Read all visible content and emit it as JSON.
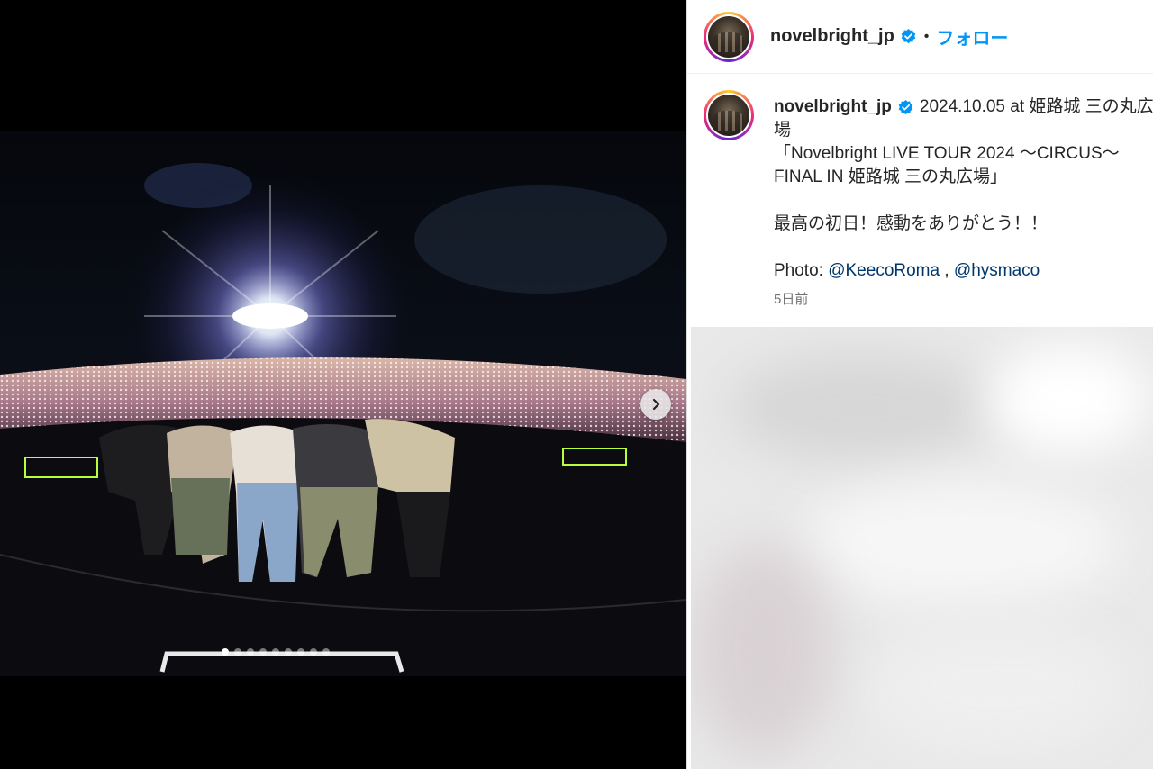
{
  "post": {
    "username": "novelbright_jp",
    "separator": "•",
    "follow_label": "フォロー",
    "caption": {
      "location_line1": "2024.10.05 at 姫路城 三の丸広",
      "location_line2": "場",
      "title_line1": "「Novelbright LIVE TOUR 2024 〜CIRCUS〜",
      "title_line2": "FINAL IN 姫路城 三の丸広場」",
      "message": "最高の初日！感動をありがとう！！",
      "photo_prefix": "Photo:",
      "mention_1": "@KeecoRoma",
      "mention_sep": ",",
      "mention_2": "@hysmaco"
    },
    "timestamp": "5日前"
  },
  "carousel": {
    "total_slides": 9,
    "current_slide": 1
  },
  "colors": {
    "accent": "#0095f6",
    "verified": "#0095f6",
    "mention": "#00376b",
    "muted": "#737373"
  },
  "icons": [
    "verified-badge-icon",
    "chevron-right-icon"
  ]
}
